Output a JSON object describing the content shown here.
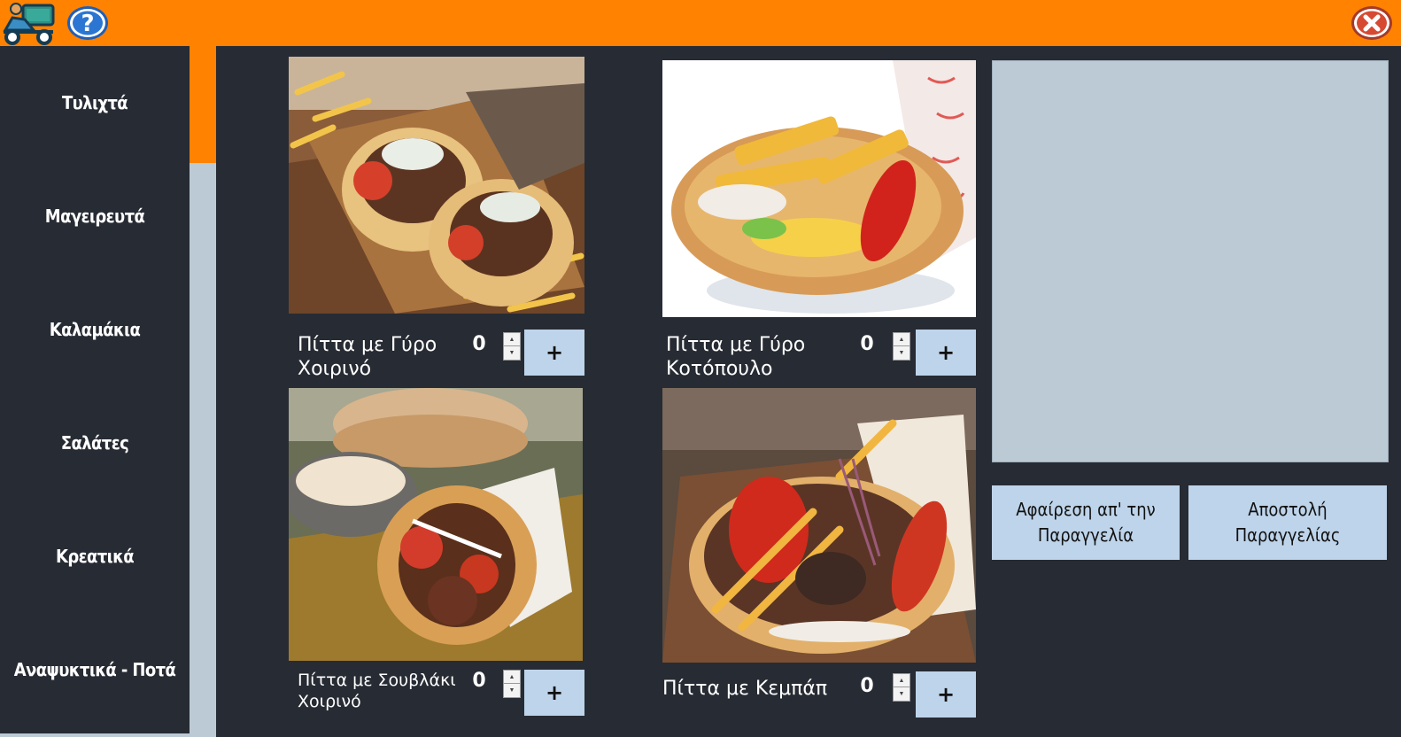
{
  "header": {
    "logo_icon": "delivery-scooter-icon",
    "help_icon": "help-icon",
    "close_icon": "close-icon",
    "bar_color": "#ff8200"
  },
  "sidebar": {
    "items": [
      {
        "label": "Τυλιχτά"
      },
      {
        "label": "Μαγειρευτά"
      },
      {
        "label": "Καλαμάκια"
      },
      {
        "label": "Σαλάτες"
      },
      {
        "label": "Κρεατικά"
      },
      {
        "label": "Αναψυκτικά - Ποτά"
      }
    ]
  },
  "products": [
    {
      "name": "Πίττα με Γύρο Χοιρινό",
      "quantity": "0",
      "add_label": "+"
    },
    {
      "name": "Πίττα με Γύρο Κοτόπουλο",
      "quantity": "0",
      "add_label": "+"
    },
    {
      "name": "Πίττα με Σουβλάκι Χοιρινό",
      "quantity": "0",
      "add_label": "+"
    },
    {
      "name": "Πίττα με Κεμπάπ",
      "quantity": "0",
      "add_label": "+"
    }
  ],
  "order": {
    "remove_label": "Αφαίρεση απ' την Παραγγελία",
    "send_label": "Αποστολή Παραγγελίας"
  },
  "colors": {
    "background": "#272b33",
    "accent": "#ff8200",
    "button": "#bed4ea",
    "panel": "#bccad5"
  }
}
